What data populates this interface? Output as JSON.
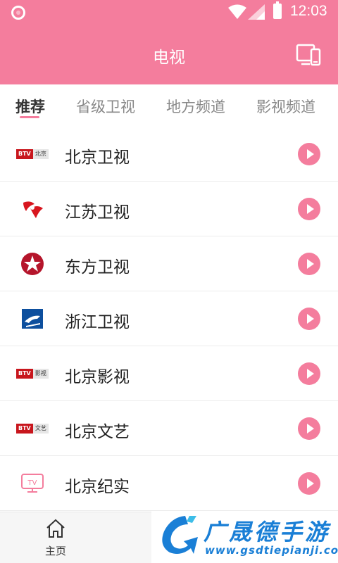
{
  "status_bar": {
    "time": "12:03"
  },
  "header": {
    "title": "电视"
  },
  "tabs": [
    {
      "label": "推荐",
      "active": true
    },
    {
      "label": "省级卫视",
      "active": false
    },
    {
      "label": "地方频道",
      "active": false
    },
    {
      "label": "影视频道",
      "active": false
    }
  ],
  "channels": [
    {
      "name": "北京卫视",
      "logo": "btv-beijing-logo",
      "logo_text": "北京"
    },
    {
      "name": "江苏卫视",
      "logo": "jiangsu-tv-logo"
    },
    {
      "name": "东方卫视",
      "logo": "dragon-tv-logo"
    },
    {
      "name": "浙江卫视",
      "logo": "zhejiang-tv-logo"
    },
    {
      "name": "北京影视",
      "logo": "btv-movie-logo",
      "logo_text": "影视"
    },
    {
      "name": "北京文艺",
      "logo": "btv-arts-logo",
      "logo_text": "文艺"
    },
    {
      "name": "北京纪实",
      "logo": "tv-icon"
    }
  ],
  "btv_badge": "BTV",
  "tv_badge": "TV",
  "bottom_nav": {
    "home_label": "主页"
  },
  "watermark": {
    "title": "广晟德手游",
    "url": "www.gsdtiepianji.com"
  },
  "colors": {
    "accent": "#f47d9d",
    "btv_red": "#c8161d",
    "watermark_blue": "#1a7fd6"
  }
}
